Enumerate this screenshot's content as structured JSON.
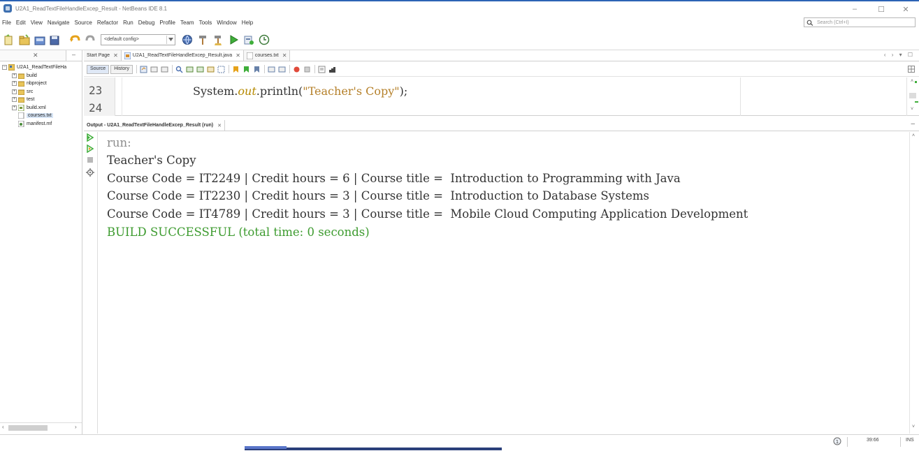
{
  "window": {
    "title": "U2A1_ReadTextFileHandleExcep_Result - NetBeans IDE 8.1",
    "controls": {
      "minimize": "–",
      "maximize": "☐",
      "close": "✕"
    }
  },
  "menu": [
    "File",
    "Edit",
    "View",
    "Navigate",
    "Source",
    "Refactor",
    "Run",
    "Debug",
    "Profile",
    "Team",
    "Tools",
    "Window",
    "Help"
  ],
  "search": {
    "placeholder": "Search (Ctrl+I)"
  },
  "toolbar": {
    "config_value": "<default config>"
  },
  "projects": {
    "root": "U2A1_ReadTextFileHa",
    "items": [
      {
        "label": "build",
        "kind": "folder"
      },
      {
        "label": "nbproject",
        "kind": "folder"
      },
      {
        "label": "src",
        "kind": "folder"
      },
      {
        "label": "test",
        "kind": "folder"
      },
      {
        "label": "build.xml",
        "kind": "xml"
      },
      {
        "label": "courses.txt",
        "kind": "file"
      },
      {
        "label": "manifest.mf",
        "kind": "file"
      }
    ]
  },
  "editor": {
    "tabs": [
      {
        "label": "Start Page"
      },
      {
        "label": "U2A1_ReadTextFileHandleExcep_Result.java"
      },
      {
        "label": "courses.txt"
      }
    ],
    "source_label": "Source",
    "history_label": "History",
    "lines": [
      {
        "number": "23",
        "pre": "System.",
        "field": "out",
        "mid": ".println(",
        "str": "\"Teacher's Copy\"",
        "post": ");"
      },
      {
        "number": "24"
      }
    ]
  },
  "output": {
    "tab_label": "Output - U2A1_ReadTextFileHandleExcep_Result (run)",
    "lines": [
      "run:",
      "Teacher's Copy",
      "Course Code = IT2249 | Credit hours = 6 | Course title =  Introduction to Programming with Java",
      "Course Code = IT2230 | Credit hours = 3 | Course title =  Introduction to Database Systems",
      "Course Code = IT4789 | Credit hours = 3 | Course title =  Mobile Cloud Computing Application Development",
      "BUILD SUCCESSFUL (total time: 0 seconds)"
    ]
  },
  "status": {
    "position": "39:66",
    "mode": "INS"
  },
  "colors": {
    "accent": "#2c63b5",
    "success": "#3d9b2f",
    "field": "#b58900",
    "string": "#b5802a"
  }
}
